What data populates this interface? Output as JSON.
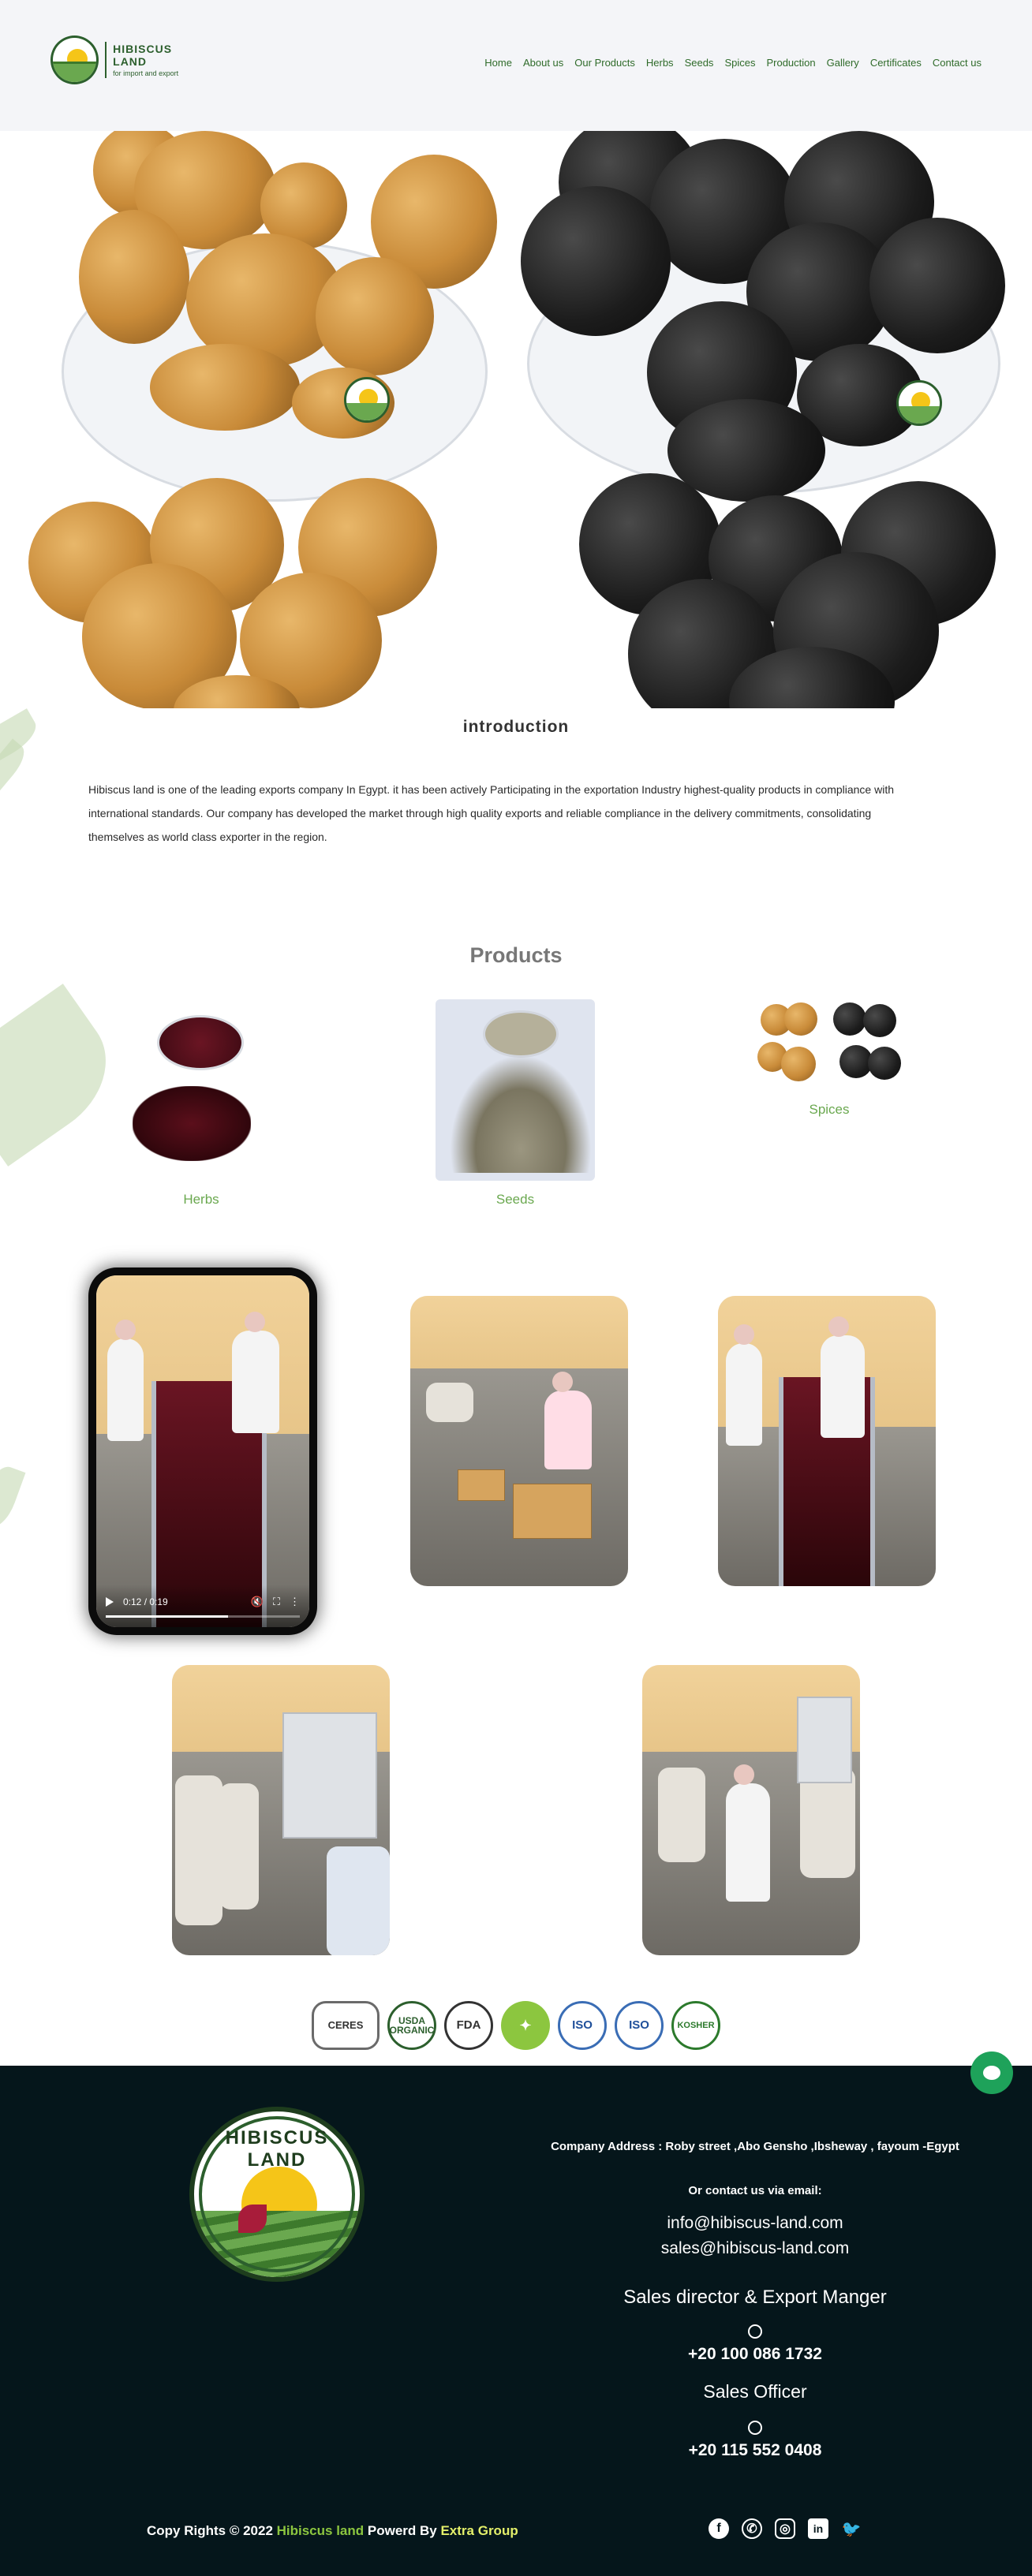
{
  "brand": {
    "name": "HIBISCUS LAND",
    "tagline": "for import and export",
    "accent": "#6aa84f",
    "dark_green": "#2c5f2d",
    "footer_bg": "#05161b"
  },
  "nav": {
    "items": [
      {
        "label": "Home"
      },
      {
        "label": "About us"
      },
      {
        "label": "Our Products"
      },
      {
        "label": "Herbs"
      },
      {
        "label": "Seeds"
      },
      {
        "label": "Spices"
      },
      {
        "label": "Production"
      },
      {
        "label": "Gallery"
      },
      {
        "label": "Certificates"
      },
      {
        "label": "Contact us"
      }
    ]
  },
  "intro": {
    "title": "introduction",
    "body": "Hibiscus land is one of the leading exports company In Egypt. it has been actively Participating in the exportation Industry highest-quality products in compliance with international standards. Our company has developed the market through high quality exports and reliable compliance in the delivery commitments, consolidating themselves as world class exporter in the region."
  },
  "products": {
    "title": "Products",
    "items": [
      {
        "label": "Herbs"
      },
      {
        "label": "Seeds"
      },
      {
        "label": "Spices"
      }
    ]
  },
  "video": {
    "time": "0:12 / 0:19",
    "progress_fraction": 0.63
  },
  "certificates": [
    {
      "label": "CERES",
      "icon": "ceres-certified-badge"
    },
    {
      "label": "USDA ORGANIC",
      "icon": "usda-organic-badge"
    },
    {
      "label": "FDA",
      "icon": "fda-badge"
    },
    {
      "label": "",
      "icon": "eu-organic-leaf-badge"
    },
    {
      "label": "ISO",
      "icon": "iso-badge"
    },
    {
      "label": "ISO",
      "icon": "iso-badge"
    },
    {
      "label": "KOSHER",
      "icon": "kosher-badge"
    }
  ],
  "footer": {
    "logo_text": "HIBISCUS LAND",
    "address": "Company Address : Roby street ,Abo Gensho ,Ibsheway ,  fayoum -Egypt",
    "or_contact": "Or contact us via email:",
    "email1": "info@hibiscus-land.com",
    "email2": "sales@hibiscus-land.com",
    "role1": "Sales director & Export Manger",
    "phone1": "+20 100 086 1732",
    "role2": "Sales Officer",
    "phone2": "+20 115 552 0408",
    "copyright_prefix": "Copy Rights © 2022 ",
    "copyright_company": "Hibiscus land",
    "copyright_mid": " Powerd By ",
    "copyright_powered": "Extra Group",
    "socials": [
      {
        "icon": "facebook-icon",
        "glyph": "f"
      },
      {
        "icon": "whatsapp-icon",
        "glyph": "✆"
      },
      {
        "icon": "instagram-icon",
        "glyph": "◎"
      },
      {
        "icon": "linkedin-icon",
        "glyph": "in"
      },
      {
        "icon": "twitter-icon",
        "glyph": "🐦"
      }
    ]
  }
}
